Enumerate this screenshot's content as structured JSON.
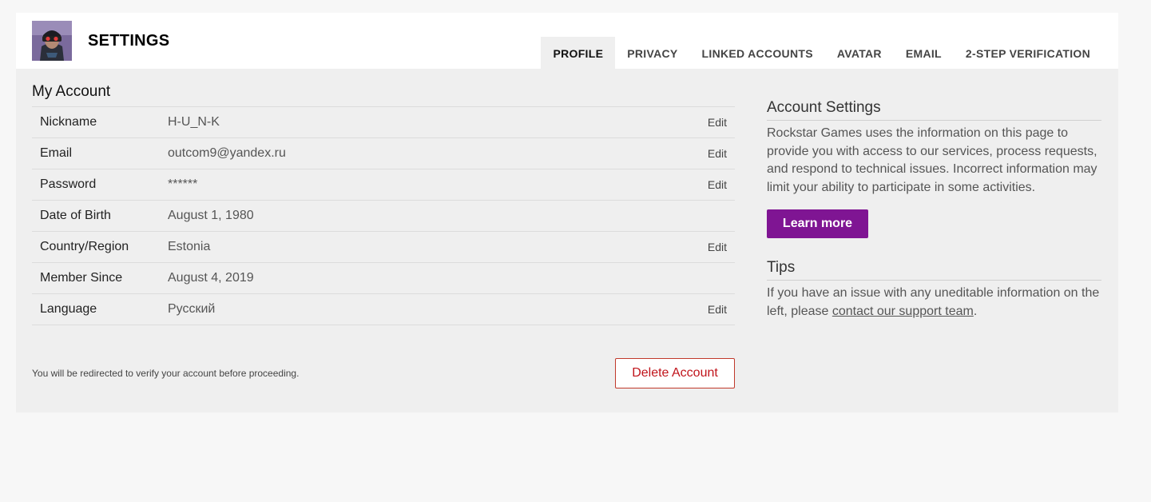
{
  "header": {
    "title": "SETTINGS",
    "tabs": [
      {
        "label": "PROFILE",
        "active": true
      },
      {
        "label": "PRIVACY",
        "active": false
      },
      {
        "label": "LINKED ACCOUNTS",
        "active": false
      },
      {
        "label": "AVATAR",
        "active": false
      },
      {
        "label": "EMAIL",
        "active": false
      },
      {
        "label": "2-STEP VERIFICATION",
        "active": false
      }
    ]
  },
  "account": {
    "title": "My Account",
    "rows": [
      {
        "label": "Nickname",
        "value": "H-U_N-K",
        "edit": "Edit"
      },
      {
        "label": "Email",
        "value": "outcom9@yandex.ru",
        "edit": "Edit"
      },
      {
        "label": "Password",
        "value": "******",
        "edit": "Edit"
      },
      {
        "label": "Date of Birth",
        "value": "August 1, 1980"
      },
      {
        "label": "Country/Region",
        "value": "Estonia",
        "edit": "Edit"
      },
      {
        "label": "Member Since",
        "value": "August 4, 2019"
      },
      {
        "label": "Language",
        "value": "Русский",
        "edit": "Edit"
      }
    ],
    "redirect_note": "You will be redirected to verify your account before proceeding.",
    "delete_label": "Delete Account"
  },
  "sidebar": {
    "settings_title": "Account Settings",
    "settings_text": "Rockstar Games uses the information on this page to provide you with access to our services, process requests, and respond to technical issues. Incorrect information may limit your ability to participate in some activities.",
    "learn_more": "Learn more",
    "tips_title": "Tips",
    "tips_text_before": "If you have an issue with any uneditable information on the left, please ",
    "tips_link": "contact our support team",
    "tips_text_after": "."
  },
  "colors": {
    "accent": "#7f1593",
    "danger": "#c0141b",
    "panel": "#efefef"
  }
}
